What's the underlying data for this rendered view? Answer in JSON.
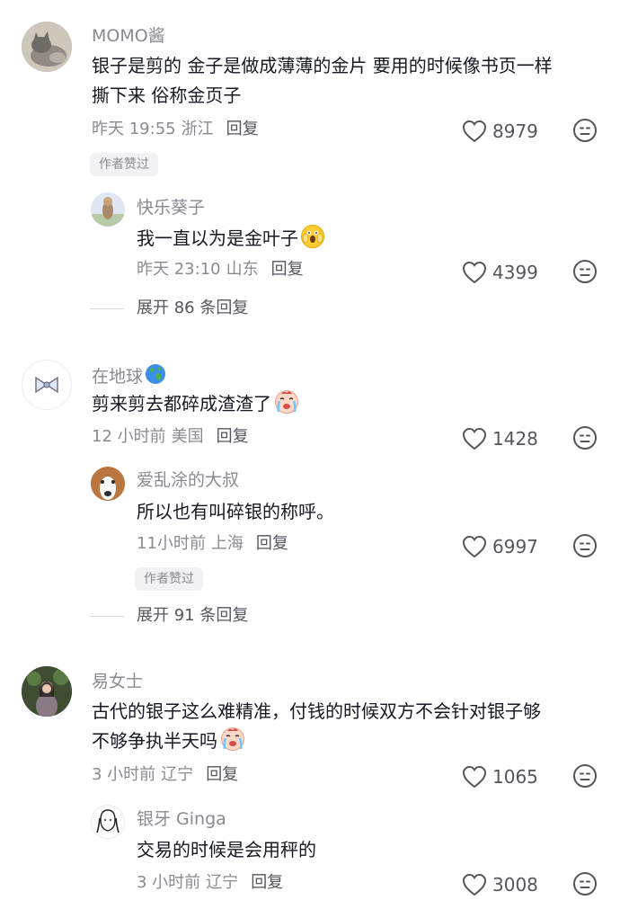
{
  "comments": [
    {
      "username": "MOMO酱",
      "content_line1": "银子是剪的 金子是做成薄薄的金片 要用的时候像书页一样",
      "content_line2": "撕下来 俗称金页子",
      "time": "昨天 19:55",
      "location": "浙江",
      "reply_label": "回复",
      "likes": "8979",
      "badge": "作者赞过",
      "replies": [
        {
          "username": "快乐葵子",
          "content": "我一直以为是金叶子",
          "emoji": "shocked-face",
          "time": "昨天 23:10",
          "location": "山东",
          "reply_label": "回复",
          "likes": "4399"
        }
      ],
      "expand_label": "展开 86 条回复"
    },
    {
      "username": "在地球",
      "username_icon": "globe-icon",
      "content": "剪来剪去都碎成渣渣了",
      "emoji": "crying-face",
      "time": "12 小时前",
      "location": "美国",
      "reply_label": "回复",
      "likes": "1428",
      "replies": [
        {
          "username": "爱乱涂的大叔",
          "content": "所以也有叫碎银的称呼。",
          "time": "11小时前",
          "location": "上海",
          "reply_label": "回复",
          "likes": "6997",
          "badge": "作者赞过"
        }
      ],
      "expand_label": "展开 91 条回复"
    },
    {
      "username": "易女士",
      "content_line1": "古代的银子这么难精准，付钱的时候双方不会针对银子够",
      "content_line2": "不够争执半天吗",
      "emoji": "crying-face",
      "time": "3 小时前",
      "location": "辽宁",
      "reply_label": "回复",
      "likes": "1065",
      "replies": [
        {
          "username": "银牙 Ginga",
          "content": "交易的时候是会用秤的",
          "time": "3 小时前",
          "location": "辽宁",
          "reply_label": "回复",
          "likes": "3008"
        }
      ]
    }
  ],
  "colors": {
    "text_primary": "#161823",
    "text_secondary": "#8a8b91",
    "badge_bg": "#f2f2f4"
  }
}
